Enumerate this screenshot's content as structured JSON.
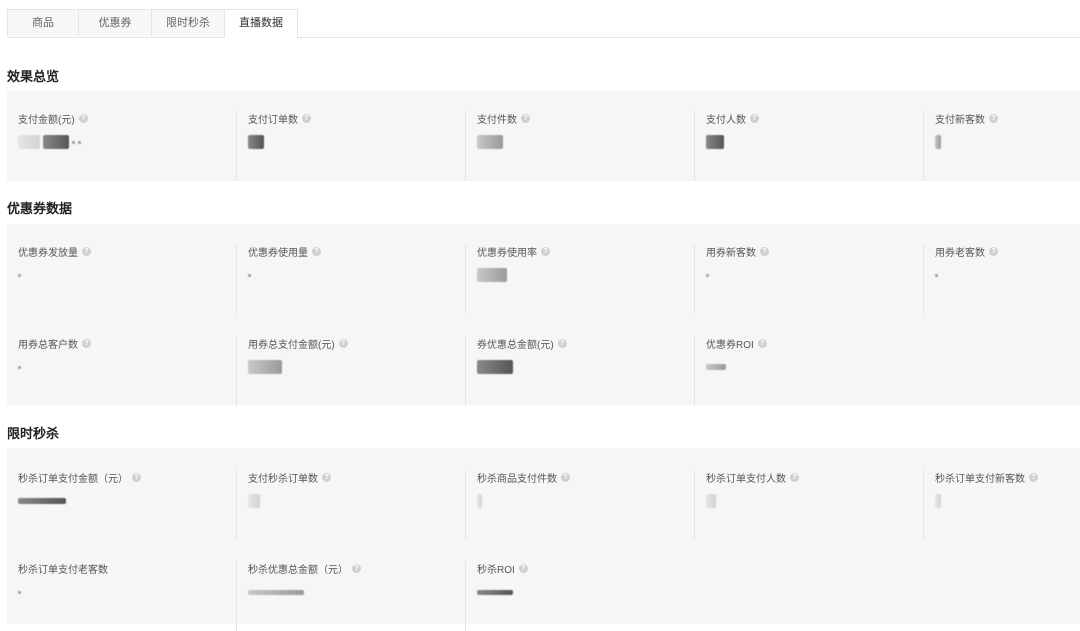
{
  "tabs": [
    {
      "label": "商品",
      "active": false
    },
    {
      "label": "优惠券",
      "active": false
    },
    {
      "label": "限时秒杀",
      "active": false
    },
    {
      "label": "直播数据",
      "active": true
    }
  ],
  "sections": {
    "overview": {
      "title": "效果总览",
      "metrics": [
        "支付金额(元)",
        "支付订单数",
        "支付件数",
        "支付人数",
        "支付新客数"
      ]
    },
    "coupon": {
      "title": "优惠券数据",
      "metrics": [
        "优惠券发放量",
        "优惠券使用量",
        "优惠券使用率",
        "用券新客数",
        "用券老客数",
        "用券总客户数",
        "用券总支付金额(元)",
        "券优惠总金额(元)",
        "优惠券ROI"
      ]
    },
    "flash": {
      "title": "限时秒杀",
      "metrics": [
        "秒杀订单支付金额（元）",
        "支付秒杀订单数",
        "秒杀商品支付件数",
        "秒杀订单支付人数",
        "秒杀订单支付新客数",
        "秒杀订单支付老客数",
        "秒杀优惠总金额（元）",
        "秒杀ROI"
      ]
    }
  },
  "colors": {
    "panel_bg": "#f6f6f6",
    "tab_border": "#e5e5e5",
    "help_icon": "#d0d0d0"
  },
  "icons": {
    "help": "question-circle-icon"
  }
}
